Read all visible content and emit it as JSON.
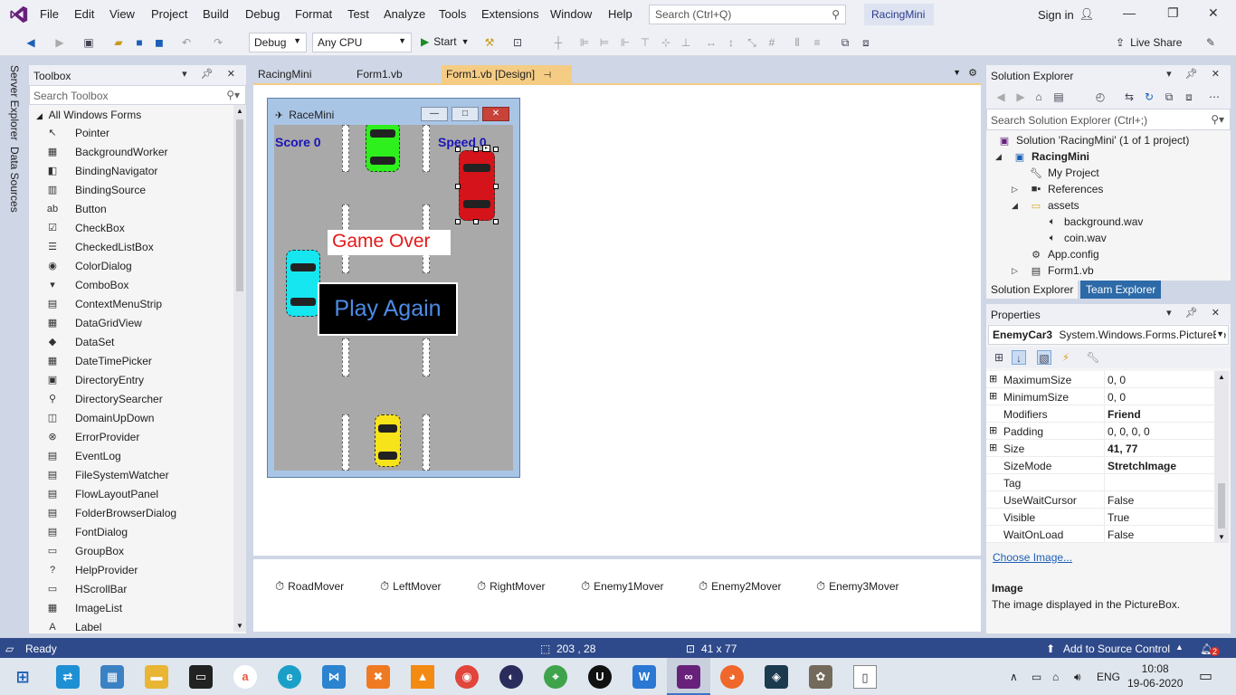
{
  "menubar": {
    "items": [
      "File",
      "Edit",
      "View",
      "Project",
      "Build",
      "Debug",
      "Format",
      "Test",
      "Analyze",
      "Tools",
      "Extensions",
      "Window",
      "Help"
    ],
    "search_placeholder": "Search (Ctrl+Q)",
    "solution_name": "RacingMini",
    "signin": "Sign in"
  },
  "toolbar": {
    "config": "Debug",
    "platform": "Any CPU",
    "start": "Start",
    "live_share": "Live Share"
  },
  "left_tabs": [
    "Server Explorer",
    "Data Sources"
  ],
  "toolbox": {
    "title": "Toolbox",
    "search_placeholder": "Search Toolbox",
    "group": "All Windows Forms",
    "items": [
      "Pointer",
      "BackgroundWorker",
      "BindingNavigator",
      "BindingSource",
      "Button",
      "CheckBox",
      "CheckedListBox",
      "ColorDialog",
      "ComboBox",
      "ContextMenuStrip",
      "DataGridView",
      "DataSet",
      "DateTimePicker",
      "DirectoryEntry",
      "DirectorySearcher",
      "DomainUpDown",
      "ErrorProvider",
      "EventLog",
      "FileSystemWatcher",
      "FlowLayoutPanel",
      "FolderBrowserDialog",
      "FontDialog",
      "GroupBox",
      "HelpProvider",
      "HScrollBar",
      "ImageList",
      "Label"
    ]
  },
  "doc_tabs": [
    "RacingMini",
    "Form1.vb",
    "Form1.vb [Design]"
  ],
  "form": {
    "title": "RaceMini",
    "score": "Score 0",
    "speed": "Speed 0",
    "game_over": "Game Over",
    "play_again": "Play Again"
  },
  "tray": [
    "RoadMover",
    "LeftMover",
    "RightMover",
    "Enemy1Mover",
    "Enemy2Mover",
    "Enemy3Mover"
  ],
  "solution_explorer": {
    "title": "Solution Explorer",
    "search_placeholder": "Search Solution Explorer (Ctrl+;)",
    "tree": {
      "solution": "Solution 'RacingMini' (1 of 1 project)",
      "project": "RacingMini",
      "my_project": "My Project",
      "references": "References",
      "assets": "assets",
      "background": "background.wav",
      "coin": "coin.wav",
      "app_config": "App.config",
      "form1": "Form1.vb"
    },
    "tab_solution": "Solution Explorer",
    "tab_team": "Team Explorer"
  },
  "properties": {
    "title": "Properties",
    "object_name": "EnemyCar3",
    "object_type": "System.Windows.Forms.PictureBo",
    "rows": [
      {
        "name": "MaximumSize",
        "value": "0, 0",
        "expand": "⊞",
        "bold": false
      },
      {
        "name": "MinimumSize",
        "value": "0, 0",
        "expand": "⊞",
        "bold": false
      },
      {
        "name": "Modifiers",
        "value": "Friend",
        "expand": "",
        "bold": true
      },
      {
        "name": "Padding",
        "value": "0, 0, 0, 0",
        "expand": "⊞",
        "bold": false
      },
      {
        "name": "Size",
        "value": "41, 77",
        "expand": "⊞",
        "bold": true
      },
      {
        "name": "SizeMode",
        "value": "StretchImage",
        "expand": "",
        "bold": true
      },
      {
        "name": "Tag",
        "value": "",
        "expand": "",
        "bold": false
      },
      {
        "name": "UseWaitCursor",
        "value": "False",
        "expand": "",
        "bold": false
      },
      {
        "name": "Visible",
        "value": "True",
        "expand": "",
        "bold": false
      },
      {
        "name": "WaitOnLoad",
        "value": "False",
        "expand": "",
        "bold": false
      }
    ],
    "choose_image": "Choose Image...",
    "desc_title": "Image",
    "desc_text": "The image displayed in the PictureBox."
  },
  "statusbar": {
    "ready": "Ready",
    "position": "203 , 28",
    "size": "41 x 77",
    "source_control": "Add to Source Control",
    "notifications": "2"
  },
  "taskbar": {
    "language": "ENG",
    "time": "10:08",
    "date": "19-06-2020"
  },
  "colors": {
    "accent": "#68217a",
    "status_bar": "#2f4a8a",
    "active_tab": "#f5cc84",
    "score_text": "#1b14b8",
    "game_over_text": "#e51a1a",
    "play_again_text": "#4d8be6"
  }
}
